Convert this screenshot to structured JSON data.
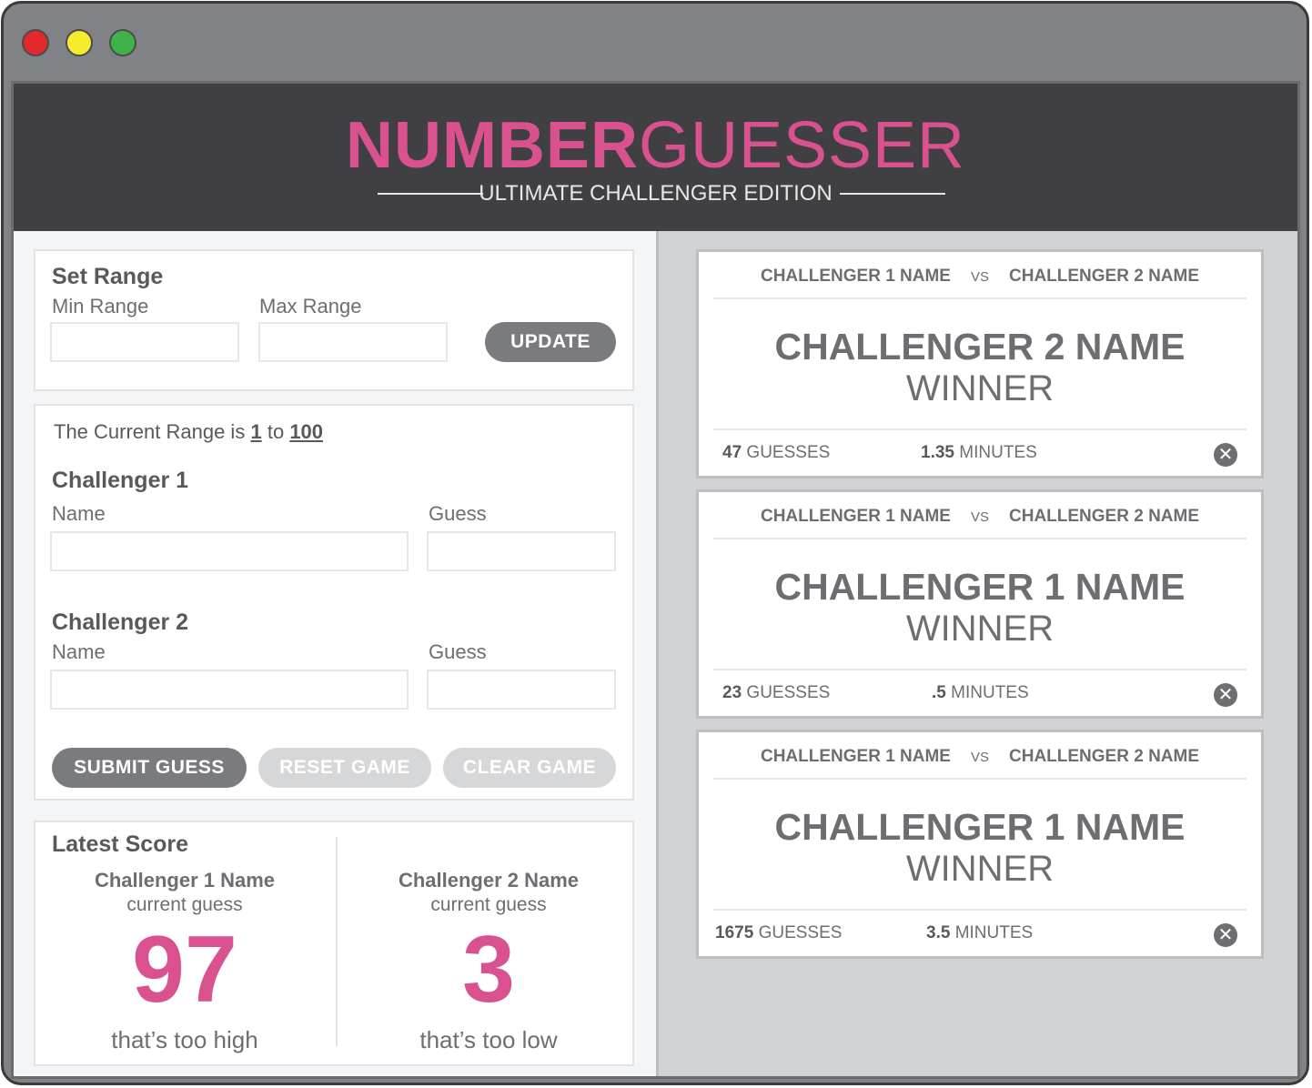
{
  "app": {
    "title_bold": "NUMBER",
    "title_light": "GUESSER",
    "tagline": "ULTIMATE CHALLENGER EDITION",
    "colors": {
      "accent": "#d9518f",
      "header_bg": "#404042",
      "button_dark": "#7a7b7e",
      "button_light": "#d6d7d9"
    }
  },
  "set_range": {
    "title": "Set Range",
    "min_label": "Min Range",
    "max_label": "Max Range",
    "min_value": "",
    "max_value": "",
    "update_label": "UPDATE"
  },
  "game": {
    "range_prefix": "The Current Range is",
    "range_min": "1",
    "range_to": "to",
    "range_max": "100",
    "challenger1": {
      "title": "Challenger 1",
      "name_label": "Name",
      "guess_label": "Guess",
      "name_value": "",
      "guess_value": ""
    },
    "challenger2": {
      "title": "Challenger 2",
      "name_label": "Name",
      "guess_label": "Guess",
      "name_value": "",
      "guess_value": ""
    },
    "submit_label": "SUBMIT GUESS",
    "reset_label": "RESET GAME",
    "clear_label": "CLEAR GAME"
  },
  "latest_score": {
    "title": "Latest Score",
    "players": [
      {
        "name": "Challenger 1 Name",
        "sub": "current guess",
        "guess": "97",
        "hint": "that’s too high"
      },
      {
        "name": "Challenger 2 Name",
        "sub": "current guess",
        "guess": "3",
        "hint": "that’s too low"
      }
    ]
  },
  "results": [
    {
      "c1": "CHALLENGER 1 NAME",
      "vs": "VS",
      "c2": "CHALLENGER 2 NAME",
      "winner_name": "CHALLENGER 2 NAME",
      "winner_label": "WINNER",
      "guesses": "47",
      "guesses_label": "GUESSES",
      "minutes": "1.35",
      "minutes_label": "MINUTES",
      "close": "✕"
    },
    {
      "c1": "CHALLENGER 1 NAME",
      "vs": "VS",
      "c2": "CHALLENGER 2 NAME",
      "winner_name": "CHALLENGER 1 NAME",
      "winner_label": "WINNER",
      "guesses": "23",
      "guesses_label": "GUESSES",
      "minutes": ".5",
      "minutes_label": "MINUTES",
      "close": "✕"
    },
    {
      "c1": "CHALLENGER 1 NAME",
      "vs": "VS",
      "c2": "CHALLENGER 2 NAME",
      "winner_name": "CHALLENGER 1 NAME",
      "winner_label": "WINNER",
      "guesses": "1675",
      "guesses_label": "GUESSES",
      "minutes": "3.5",
      "minutes_label": "MINUTES",
      "close": "✕"
    }
  ]
}
